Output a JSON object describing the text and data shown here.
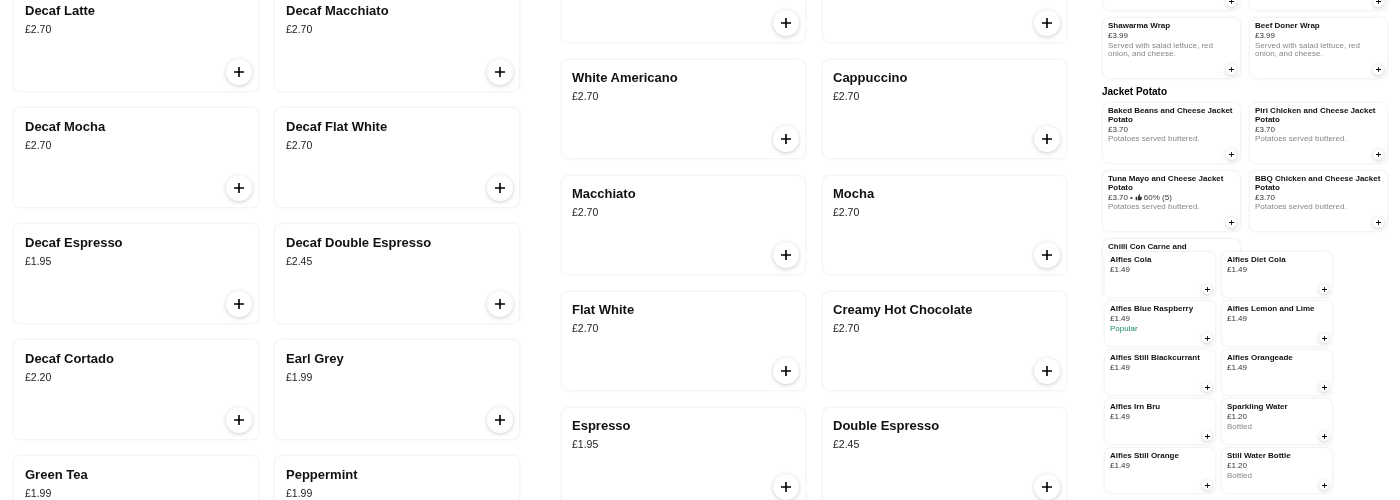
{
  "panels": [
    {
      "kind": "large",
      "sections": [
        {
          "items": [
            {
              "name": "Decaf Latte",
              "price": "£2.70"
            },
            {
              "name": "Decaf Macchiato",
              "price": "£2.70"
            },
            {
              "name": "Decaf Mocha",
              "price": "£2.70"
            },
            {
              "name": "Decaf Flat White",
              "price": "£2.70"
            },
            {
              "name": "Decaf Espresso",
              "price": "£1.95"
            },
            {
              "name": "Decaf Double Espresso",
              "price": "£2.45"
            },
            {
              "name": "Decaf Cortado",
              "price": "£2.20"
            },
            {
              "name": "Earl Grey",
              "price": "£1.99"
            },
            {
              "name": "Green Tea",
              "price": "£1.99"
            },
            {
              "name": "Peppermint",
              "price": "£1.99"
            }
          ]
        }
      ]
    },
    {
      "kind": "medium",
      "sections": [
        {
          "items": [
            {
              "kind": "cropped"
            },
            {
              "kind": "cropped"
            },
            {
              "name": "White Americano",
              "price": "£2.70"
            },
            {
              "name": "Cappuccino",
              "price": "£2.70"
            },
            {
              "name": "Macchiato",
              "price": "£2.70"
            },
            {
              "name": "Mocha",
              "price": "£2.70"
            },
            {
              "name": "Flat White",
              "price": "£2.70"
            },
            {
              "name": "Creamy Hot Chocolate",
              "price": "£2.70"
            },
            {
              "name": "Espresso",
              "price": "£1.95"
            },
            {
              "name": "Double Espresso",
              "price": "£2.45"
            }
          ]
        }
      ]
    },
    {
      "kind": "small",
      "sections": [
        {
          "items": [
            {
              "kind": "cropped"
            },
            {
              "kind": "cropped"
            },
            {
              "name": "Shawarma Wrap",
              "price": "£3.99",
              "description": "Served with salad lettuce, red onion, and cheese."
            },
            {
              "name": "Beef Doner Wrap",
              "price": "£3.99",
              "description": "Served with salad lettuce, red onion, and cheese."
            }
          ]
        },
        {
          "heading": "Jacket Potato",
          "items": [
            {
              "name": "Baked Beans and Cheese Jacket Potato",
              "price": "£3.70",
              "description": "Potatoes served buttered."
            },
            {
              "name": "Piri Chicken and Cheese Jacket Potato",
              "price": "£3.70",
              "description": "Potatoes served buttered."
            },
            {
              "name": "Tuna Mayo and Cheese Jacket Potato",
              "price": "£3.70",
              "separator": "•",
              "rating": "60% (5)",
              "description": "Potatoes served buttered."
            },
            {
              "name": "BBQ Chicken and Cheese Jacket Potato",
              "price": "£3.70",
              "description": "Potatoes served buttered."
            },
            {
              "kind": "covered",
              "name": "Chilli Con Carne and"
            }
          ]
        }
      ],
      "overlay": {
        "items": [
          {
            "name": "Alfies Cola",
            "price": "£1.49"
          },
          {
            "name": "Alfies Diet Cola",
            "price": "£1.49"
          },
          {
            "name": "Alfies Blue Raspberry",
            "price": "£1.49",
            "tag": "Popular"
          },
          {
            "name": "Alfies Lemon and Lime",
            "price": "£1.49"
          },
          {
            "name": "Alfies Still Blackcurrant",
            "price": "£1.49"
          },
          {
            "name": "Alfies Orangeade",
            "price": "£1.49"
          },
          {
            "name": "Alfies Irn Bru",
            "price": "£1.49"
          },
          {
            "name": "Sparkling Water",
            "price": "£1.20",
            "note": "Bottled"
          },
          {
            "name": "Alfies Still Orange",
            "price": "£1.49"
          },
          {
            "name": "Still Water Bottle",
            "price": "£1.20",
            "note": "Bottled"
          }
        ]
      }
    }
  ]
}
